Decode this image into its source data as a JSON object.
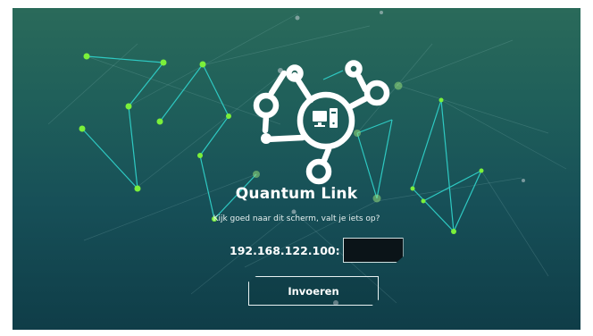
{
  "app": {
    "title": "Quantum Link",
    "subtitle": "Kijk goed naar dit scherm, valt je iets op?",
    "ip_label": "192.168.122.100:",
    "code_value": "",
    "submit_label": "Invoeren"
  },
  "colors": {
    "accent_line": "#2ec9c2",
    "node_green": "#7bf03a",
    "logo_white": "#ffffff"
  },
  "icons": {
    "logo": "network-computer-icon"
  }
}
